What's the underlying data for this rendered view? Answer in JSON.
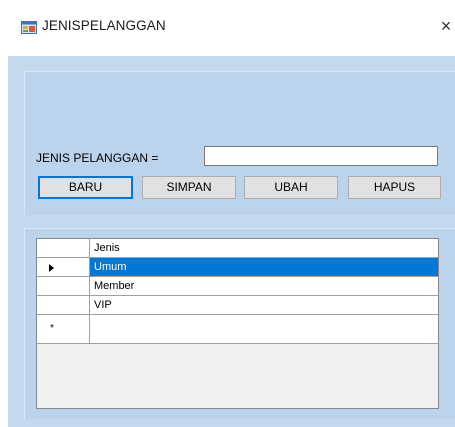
{
  "window": {
    "title": "JENISPELANGGAN",
    "close_glyph": "×",
    "app_icon": "form-icon"
  },
  "form": {
    "label": "JENIS PELANGGAN =",
    "input_value": ""
  },
  "buttons": {
    "baru": "BARU",
    "simpan": "SIMPAN",
    "ubah": "UBAH",
    "hapus": "HAPUS"
  },
  "grid": {
    "column_header": "Jenis",
    "rows": [
      "Umum",
      "Member",
      "VIP"
    ],
    "selected_row": 0,
    "new_row_glyph": "*"
  },
  "colors": {
    "client_bg": "#c4d8ee",
    "selection": "#0078d7",
    "default_button_border": "#0078d7"
  }
}
